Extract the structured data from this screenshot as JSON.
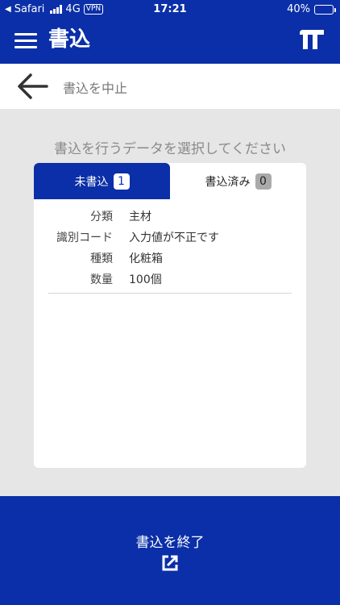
{
  "status": {
    "carrier": "Safari",
    "network": "4G",
    "vpn": "VPN",
    "time": "17:21",
    "battery": "40%",
    "battery_level": 0.4
  },
  "appbar": {
    "title": "書込"
  },
  "backbar": {
    "label": "書込を中止"
  },
  "prompt": "書込を行うデータを選択してください",
  "tabs": [
    {
      "label": "未書込",
      "count": "1"
    },
    {
      "label": "書込済み",
      "count": "0"
    }
  ],
  "items": [
    {
      "rows": [
        {
          "label": "分類",
          "value": "主材"
        },
        {
          "label": "識別コード",
          "value": "入力値が不正です"
        },
        {
          "label": "種類",
          "value": "化粧箱"
        },
        {
          "label": "数量",
          "value": "100個"
        }
      ]
    }
  ],
  "footer": {
    "label": "書込を終了"
  },
  "colors": {
    "primary": "#0b2fa8",
    "battery": "#ffd60a",
    "background": "#e6e6e6"
  },
  "icons": {
    "menu": "hamburger-icon",
    "logo": "brand-logo-icon",
    "back": "arrow-left-icon",
    "finish": "external-link-icon"
  }
}
